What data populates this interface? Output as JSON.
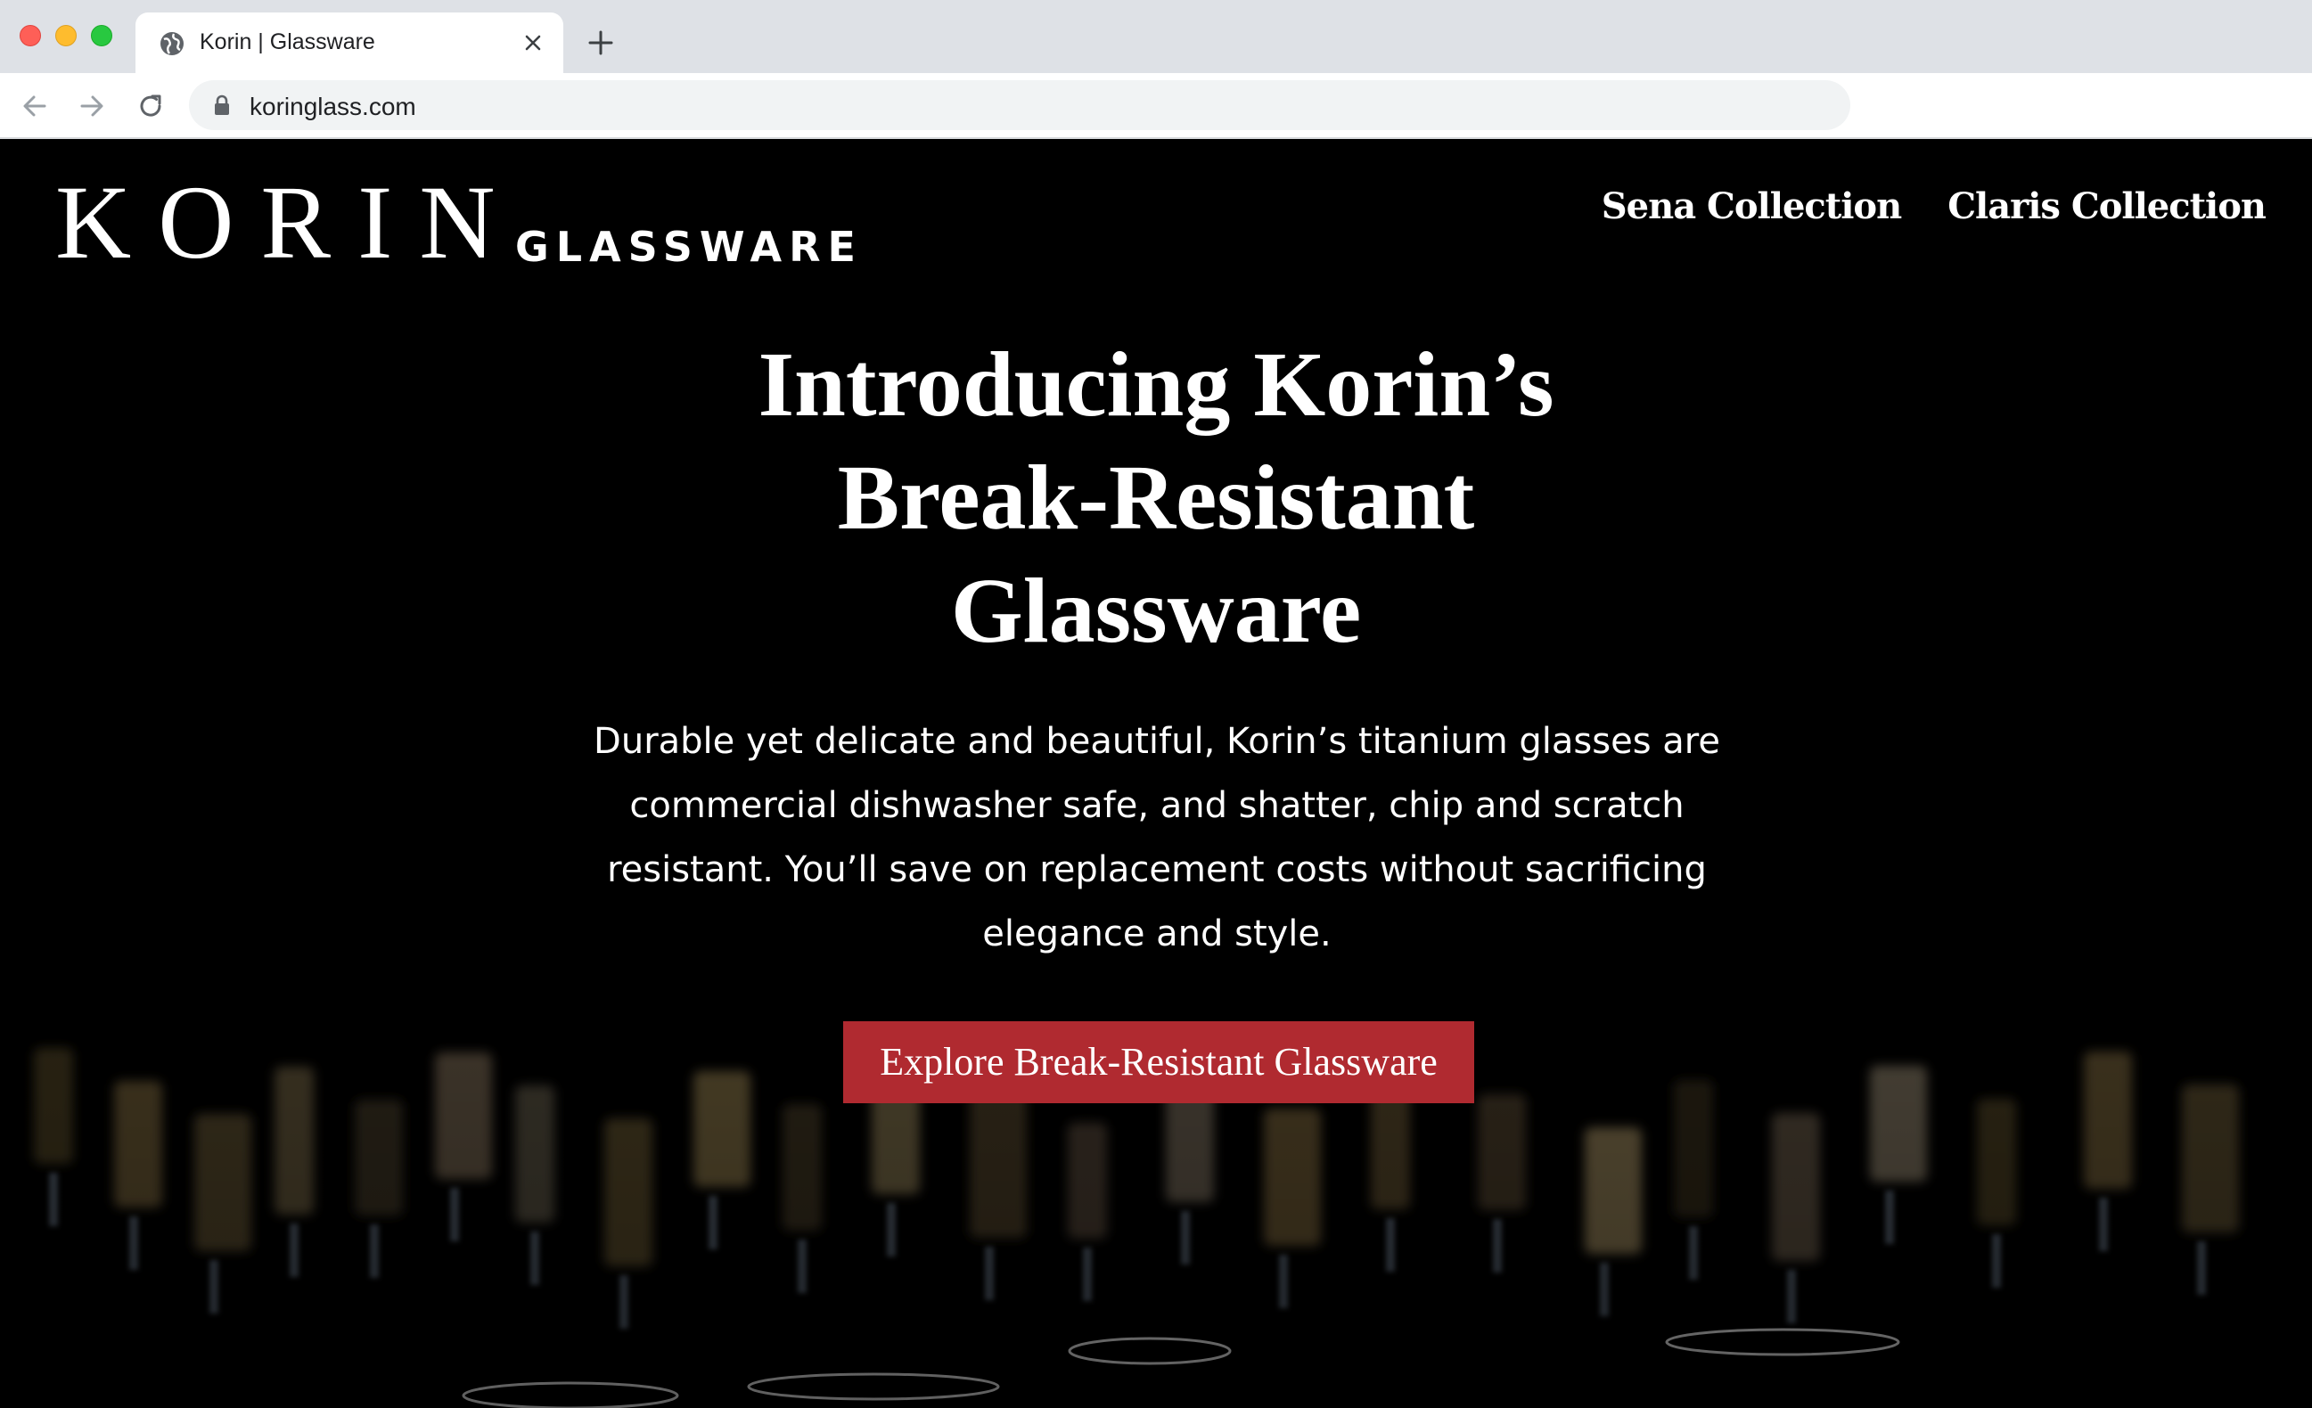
{
  "browser": {
    "tab_title": "Korin | Glassware",
    "url": "koringlass.com"
  },
  "site": {
    "logo_wordmark": "KORIN",
    "logo_subtitle": "GLASSWARE",
    "nav": [
      {
        "label": "Sena Collection"
      },
      {
        "label": "Claris Collection"
      }
    ]
  },
  "hero": {
    "title_lines": [
      "Introducing Korin’s",
      "Break-Resistant",
      "Glassware"
    ],
    "body": "Durable yet delicate and beautiful, Korin’s titanium glasses are commercial dishwasher safe, and shatter, chip and scratch resistant. You’ll save on replacement costs without sacrificing elegance and style.",
    "cta_label": "Explore Break-Resistant Glassware"
  },
  "colors": {
    "page_background": "#000000",
    "cta_background": "#b02a30",
    "text": "#ffffff"
  },
  "icons": [
    "globe-icon",
    "close-icon",
    "plus-icon",
    "arrow-left-icon",
    "arrow-right-icon",
    "reload-icon",
    "lock-icon"
  ]
}
